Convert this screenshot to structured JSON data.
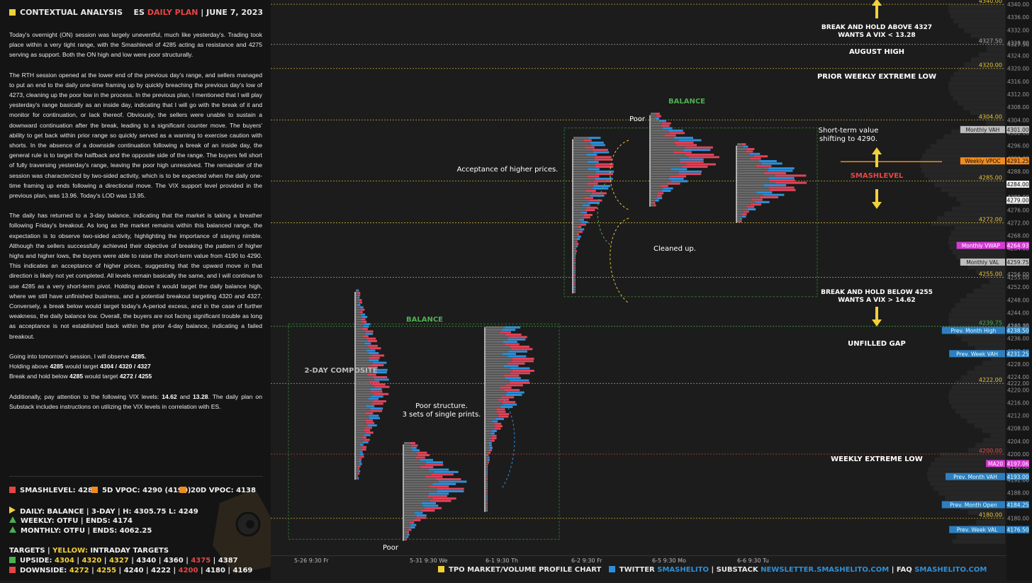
{
  "header": {
    "title": "CONTEXTUAL ANALYSIS",
    "instrument": "ES",
    "plan_label": "DAILY PLAN",
    "date": "| JUNE 7, 2023"
  },
  "analysis": {
    "p1": "Today's overnight (ON) session was largely uneventful, much like yesterday's. Trading took place within a very tight range, with the Smashlevel of 4285 acting as resistance and 4275 serving as support. Both the ON high and low were poor structurally.",
    "p2": "The RTH session opened at the lower end of the previous day's range, and sellers managed to put an end to the daily one-time framing up by quickly breaching the previous day's low of 4273, cleaning up the poor low in the process. In the previous plan, I mentioned that I will play yesterday's range basically as an inside day, indicating that I will go with the break of it and monitor for continuation, or lack thereof. Obviously, the sellers were unable to sustain a downward continuation after the break, leading to a significant counter move. The buyers' ability to get back within prior range so quickly served as a warning to exercise caution with shorts. In the absence of a downside continuation following a break of an inside day, the general rule is to target the halfback and the opposite side of the range. The buyers fell short of fully traversing yesterday's range, leaving the poor high unresolved. The remainder of the session was characterized by two-sided activity, which is to be expected when the daily one-time framing up ends following a directional move. The VIX support level provided in the previous plan, was 13.96. Today's LOD was 13.95.",
    "p3": "The daily has returned to a 3-day balance, indicating that the market is taking a breather following Friday's breakout. As long as the market remains within this balanced range, the expectation is to observe two-sided activity, highlighting the importance of staying nimble. Although the sellers successfully achieved their objective of breaking the pattern of higher highs and higher lows, the buyers were able to raise the short-term value from 4190 to 4290. This indicates an acceptance of higher prices, suggesting that the upward move in that direction is likely not yet completed. All levels remain basically the same, and I will continue to use 4285 as a very short-term pivot. Holding above it would target the daily balance high, where we still have unfinished business, and a potential breakout targeting 4320 and 4327. Conversely, a break below would target today's A-period excess, and in the case of further weakness, the daily balance low. Overall, the buyers are not facing significant trouble as long as acceptance is not established back within the prior 4-day balance, indicating a failed breakout.",
    "p4_intro": "Going into tomorrow's session, I will observe ",
    "p4_pivot": "4285.",
    "p4_l1a": "Holding above ",
    "p4_l1b": "4285",
    "p4_l1c": " would target ",
    "p4_l1d": "4304 / 4320 / 4327",
    "p4_l2a": "Break and hold below ",
    "p4_l2b": "4285",
    "p4_l2c": " would target ",
    "p4_l2d": "4272 / 4255",
    "p5a": "Additionally, pay attention to the following VIX levels: ",
    "p5b": "14.62",
    "p5c": " and ",
    "p5d": "13.28",
    "p5e": ". The daily plan on Substack includes instructions on utilizing the VIX levels in correlation with ES."
  },
  "levels_summary": {
    "smashlevel": "SMASHLEVEL: 4285",
    "vpoc5d": "5D VPOC: 4290 (4190)",
    "vpoc20d": "20D VPOC: 4138",
    "daily": "DAILY: BALANCE  |  3-DAY  |  H: 4305.75 L: 4249",
    "weekly": "WEEKLY: OTFU  |  ENDS: 4174",
    "monthly": "MONTHLY: OTFU  |  ENDS: 4062.25"
  },
  "targets": {
    "title": "TARGETS",
    "sep": " | ",
    "yellow_label": "YELLOW:",
    "yellow_rest": " INTRADAY TARGETS",
    "upside_label": "UPSIDE:",
    "downside_label": "DOWNSIDE:",
    "upside": [
      {
        "v": "4304",
        "c": "yellow"
      },
      {
        "v": "4320",
        "c": "yellow"
      },
      {
        "v": "4327",
        "c": "yellow"
      },
      {
        "v": "4340",
        "c": "white"
      },
      {
        "v": "4360",
        "c": "white"
      },
      {
        "v": "4375",
        "c": "red"
      },
      {
        "v": "4387",
        "c": "white"
      }
    ],
    "downside": [
      {
        "v": "4272",
        "c": "yellow"
      },
      {
        "v": "4255",
        "c": "yellow"
      },
      {
        "v": "4240",
        "c": "white"
      },
      {
        "v": "4222",
        "c": "white"
      },
      {
        "v": "4200",
        "c": "red"
      },
      {
        "v": "4180",
        "c": "white"
      },
      {
        "v": "4169",
        "c": "white"
      }
    ]
  },
  "footer": {
    "chart_label": "TPO MARKET/VOLUME PROFILE CHART",
    "twitter_label": "TWITTER",
    "twitter_handle": "SMASHELITO",
    "substack_label": "| SUBSTACK",
    "substack_url": "NEWSLETTER.SMASHELITO.COM",
    "faq_label": "| FAQ",
    "faq_url": "SMASHELITO.COM"
  },
  "colors": {
    "yellow": "#f2d03b",
    "red": "#e64545",
    "orange": "#f28a1c",
    "green": "#4caf50",
    "blue": "#2e90d8",
    "magenta": "#d63ad6",
    "grey": "#8a8a8a"
  },
  "chart_data": {
    "type": "tpo_volume_profile",
    "instrument": "ES",
    "price_axis": {
      "min": 4172,
      "max": 4340,
      "ticks": [
        "4340.00",
        "4336.00",
        "4332.00",
        "4328.00",
        "4327.50",
        "4324.00",
        "4320.00",
        "4316.00",
        "4312.00",
        "4308.00",
        "4304.00",
        "4300.00",
        "4296.00",
        "4292.00",
        "4288.00",
        "4284.00",
        "4280.00",
        "4276.00",
        "4272.00",
        "4268.00",
        "4264.00",
        "4260.00",
        "4256.00",
        "4255.00",
        "4252.00",
        "4248.00",
        "4244.00",
        "4240.00",
        "4239.75",
        "4236.00",
        "4232.00",
        "4228.00",
        "4224.00",
        "4222.00",
        "4220.00",
        "4216.00",
        "4212.00",
        "4208.00",
        "4204.00",
        "4200.00",
        "4196.00",
        "4192.00",
        "4188.00",
        "4184.00",
        "4180.00",
        "4176.00"
      ]
    },
    "time_axis": [
      "5-26  9:30 Fr",
      "5-31  9:30 We",
      "6-1  9:30 Th",
      "6-2  9:30 Fr",
      "6-5  9:30 Mo",
      "6-6  9:30 Tu"
    ],
    "key_levels": [
      {
        "price": 4340,
        "label": "4340.00",
        "color": "yellow"
      },
      {
        "price": 4327.5,
        "label": "4327.50",
        "color": "white",
        "note": "AUGUST HIGH"
      },
      {
        "price": 4320,
        "label": "4320.00",
        "color": "yellow",
        "note": "PRIOR WEEKLY EXTREME LOW"
      },
      {
        "price": 4304,
        "label": "4304.00",
        "color": "yellow"
      },
      {
        "price": 4285,
        "label": "4285.00",
        "color": "yellow"
      },
      {
        "price": 4272,
        "label": "4272.00",
        "color": "yellow"
      },
      {
        "price": 4255,
        "label": "4255.00",
        "color": "yellow"
      },
      {
        "price": 4239.75,
        "label": "4239.75",
        "color": "green",
        "note": "UNFILLED GAP"
      },
      {
        "price": 4222,
        "label": "4222.00",
        "color": "yellow"
      },
      {
        "price": 4200,
        "label": "4200.00",
        "color": "red",
        "note": "WEEKLY EXTREME LOW"
      },
      {
        "price": 4180,
        "label": "4180.00",
        "color": "yellow"
      }
    ],
    "reference_tags": [
      {
        "name": "Monthly VAH",
        "value": "4301.00",
        "color": "grey"
      },
      {
        "name": "Weekly VPOC",
        "value": "4291.25",
        "color": "orange"
      },
      {
        "name": "",
        "value": "4284.00",
        "color": "white"
      },
      {
        "name": "",
        "value": "4279.00",
        "color": "white"
      },
      {
        "name": "Monthly VWAP",
        "value": "4264.93",
        "color": "magenta"
      },
      {
        "name": "Monthly VAL",
        "value": "4259.75",
        "color": "grey"
      },
      {
        "name": "Prev. Month High",
        "value": "4238.50",
        "color": "blue"
      },
      {
        "name": "Prev. Week VAH",
        "value": "4231.25",
        "color": "blue"
      },
      {
        "name": "MA20",
        "value": "4197.06",
        "color": "magenta"
      },
      {
        "name": "Prev. Month VAH",
        "value": "4193.00",
        "color": "blue"
      },
      {
        "name": "Prev. Month Open",
        "value": "4184.25",
        "color": "blue"
      },
      {
        "name": "Prev. Week VAL",
        "value": "4176.50",
        "color": "blue"
      }
    ],
    "annotations": [
      "BREAK AND HOLD ABOVE 4327\nWANTS A VIX < 13.28",
      "AUGUST HIGH",
      "PRIOR WEEKLY EXTREME LOW",
      "BALANCE",
      "Poor",
      "Acceptance of higher prices.",
      "Short-term value\nshifting to 4290.",
      "SMASHLEVEL",
      "Cleaned up.",
      "BREAK AND HOLD BELOW 4255\nWANTS A VIX > 14.62",
      "UNFILLED GAP",
      "BALANCE",
      "2-DAY COMPOSITE",
      "Poor structure.\n3 sets of single prints.",
      "WEEKLY EXTREME LOW",
      "Poor"
    ]
  }
}
